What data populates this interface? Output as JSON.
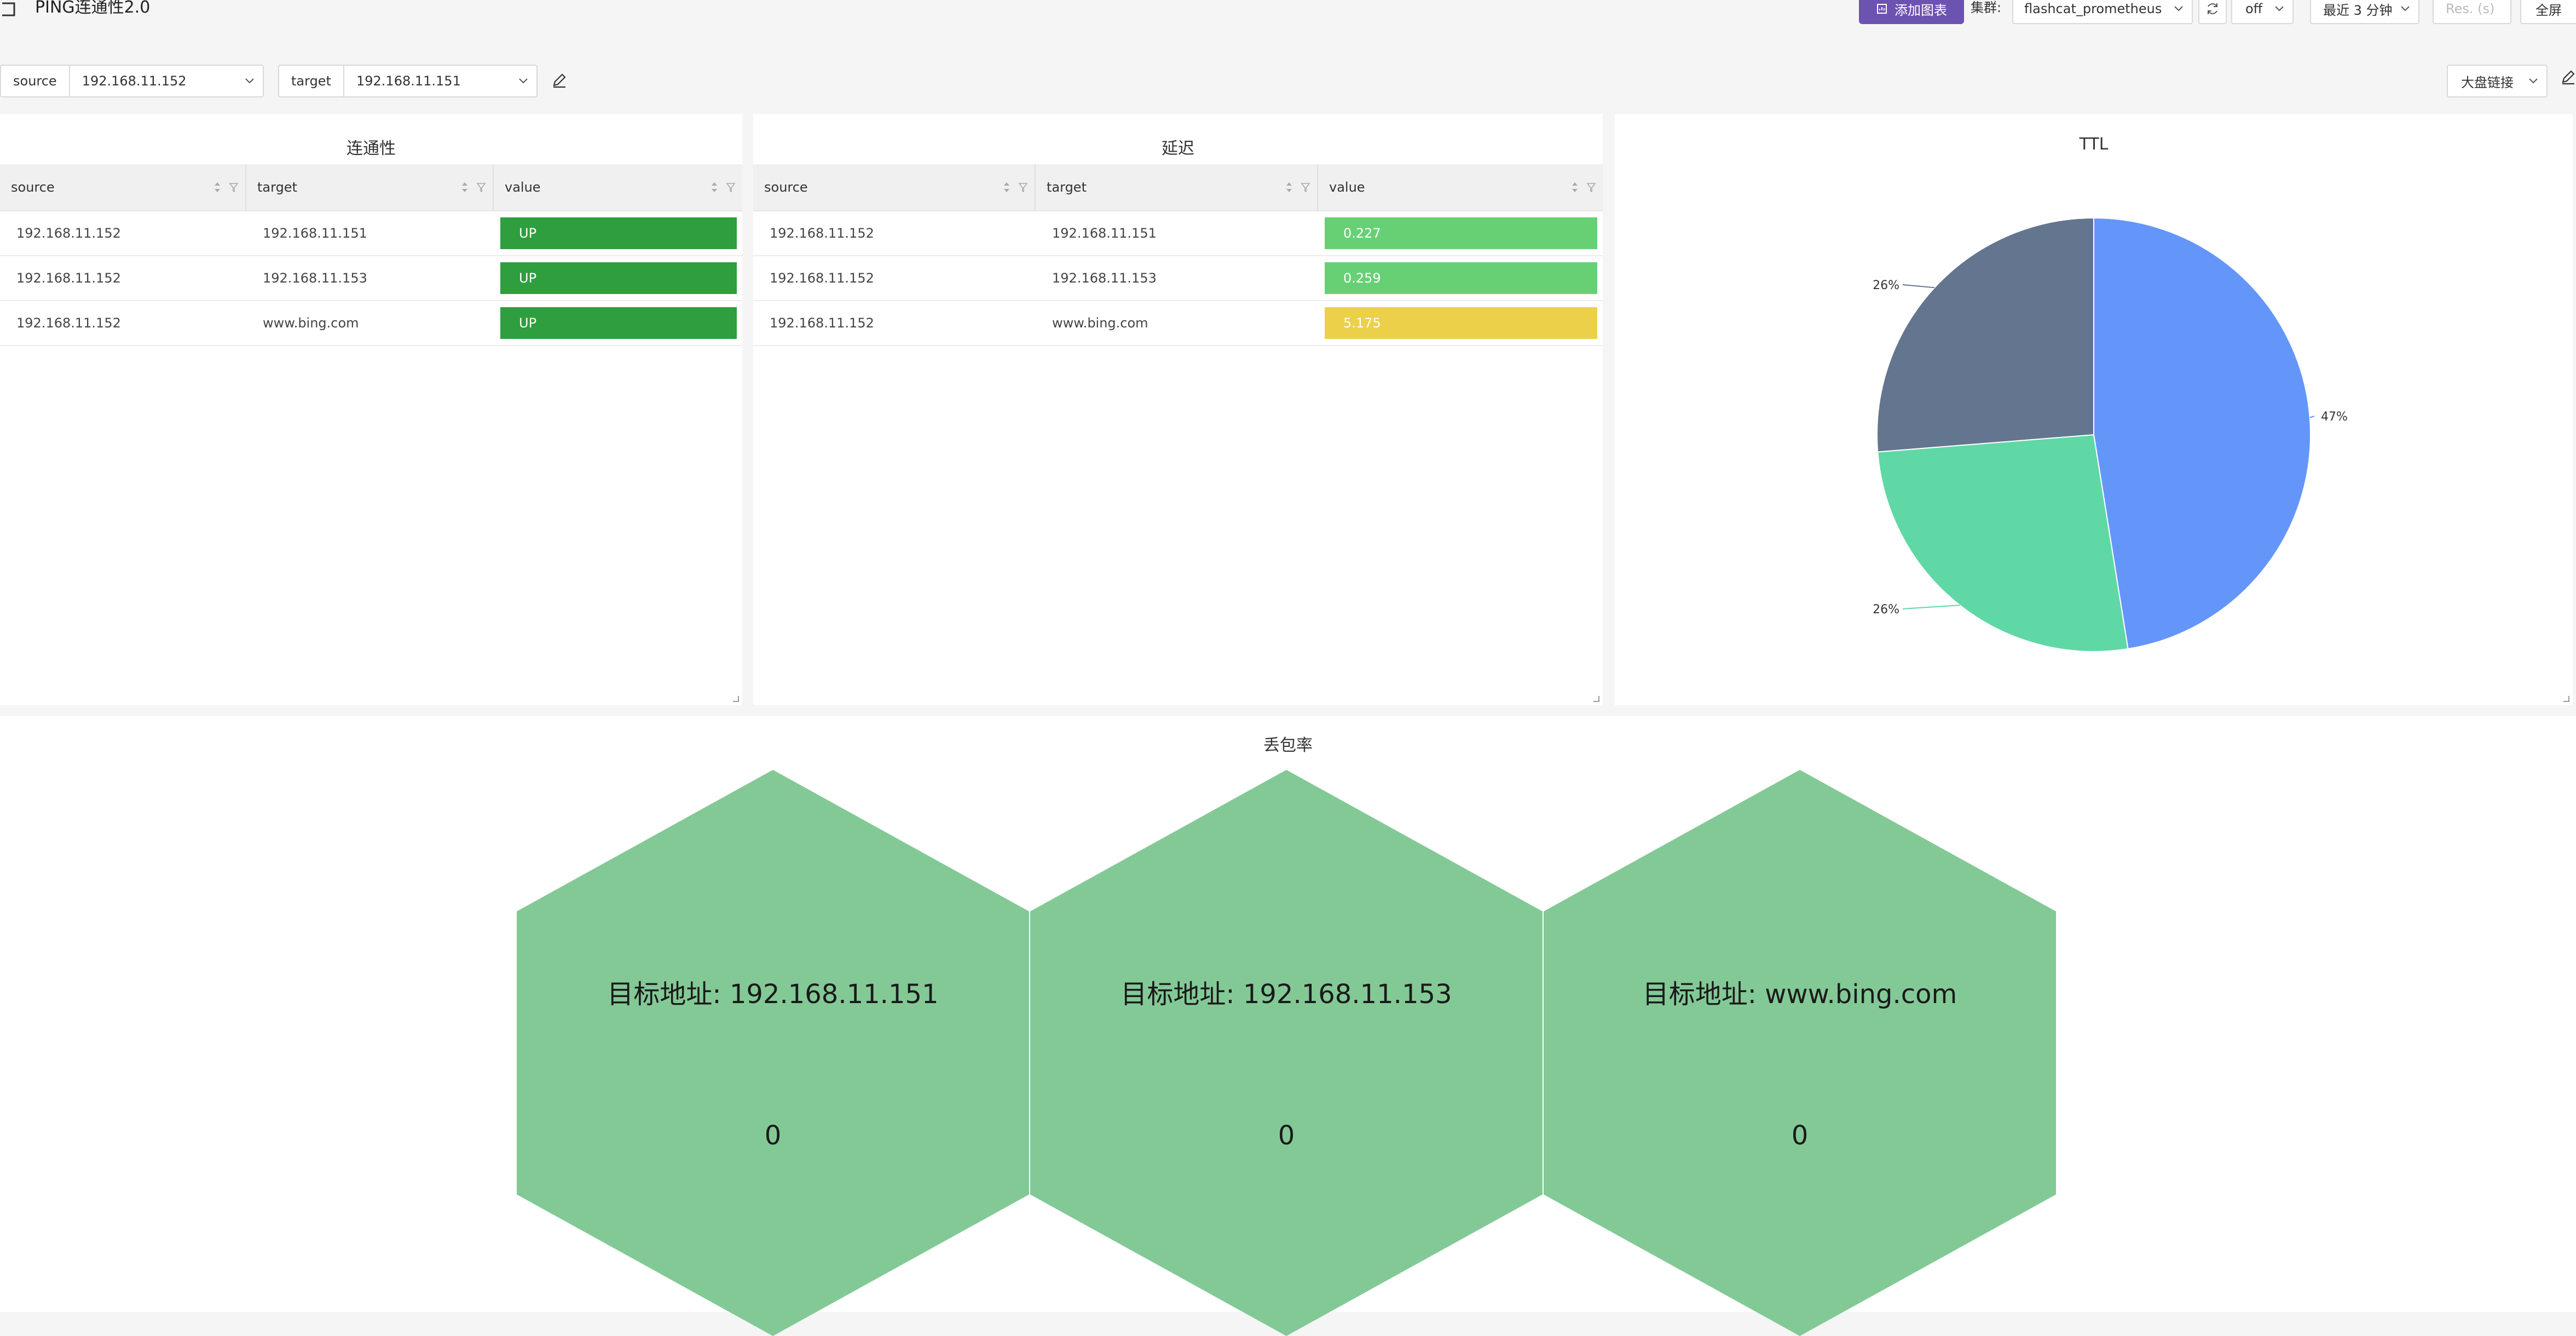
{
  "header": {
    "title": "PING连通性2.0",
    "add_chart_label": "添加图表",
    "cluster_label": "集群:",
    "cluster_value": "flashcat_prometheus",
    "refresh_value": "off",
    "time_range": "最近 3 分钟",
    "res_placeholder": "Res. (s)",
    "fullscreen_label": "全屏",
    "accent_color": "#6c53b1"
  },
  "variables": {
    "source_label": "source",
    "source_value": "192.168.11.152",
    "target_label": "target",
    "target_value": "192.168.11.151",
    "dashboard_link_label": "大盘链接"
  },
  "connectivity": {
    "title": "连通性",
    "columns": [
      "source",
      "target",
      "value"
    ],
    "rows": [
      {
        "source": "192.168.11.152",
        "target": "192.168.11.151",
        "value": "UP",
        "color": "#2e9e3e"
      },
      {
        "source": "192.168.11.152",
        "target": "192.168.11.153",
        "value": "UP",
        "color": "#2e9e3e"
      },
      {
        "source": "192.168.11.152",
        "target": "www.bing.com",
        "value": "UP",
        "color": "#2e9e3e"
      }
    ]
  },
  "latency": {
    "title": "延迟",
    "columns": [
      "source",
      "target",
      "value"
    ],
    "rows": [
      {
        "source": "192.168.11.152",
        "target": "192.168.11.151",
        "value": "0.227",
        "color": "#67d074"
      },
      {
        "source": "192.168.11.152",
        "target": "192.168.11.153",
        "value": "0.259",
        "color": "#67d074"
      },
      {
        "source": "192.168.11.152",
        "target": "www.bing.com",
        "value": "5.175",
        "color": "#ecd04a"
      }
    ]
  },
  "ttl": {
    "title": "TTL",
    "chart_data": {
      "type": "pie",
      "slices": [
        {
          "label": "47%",
          "value": 47,
          "color": "#6496fa"
        },
        {
          "label": "26%",
          "value": 26,
          "color": "#5fd8a6"
        },
        {
          "label": "26%",
          "value": 26,
          "color": "#64758f"
        }
      ]
    }
  },
  "packet_loss": {
    "title": "丢包率",
    "items": [
      {
        "label": "目标地址: 192.168.11.151",
        "value": "0"
      },
      {
        "label": "目标地址: 192.168.11.153",
        "value": "0"
      },
      {
        "label": "目标地址: www.bing.com",
        "value": "0"
      }
    ],
    "color": "#83c996"
  }
}
